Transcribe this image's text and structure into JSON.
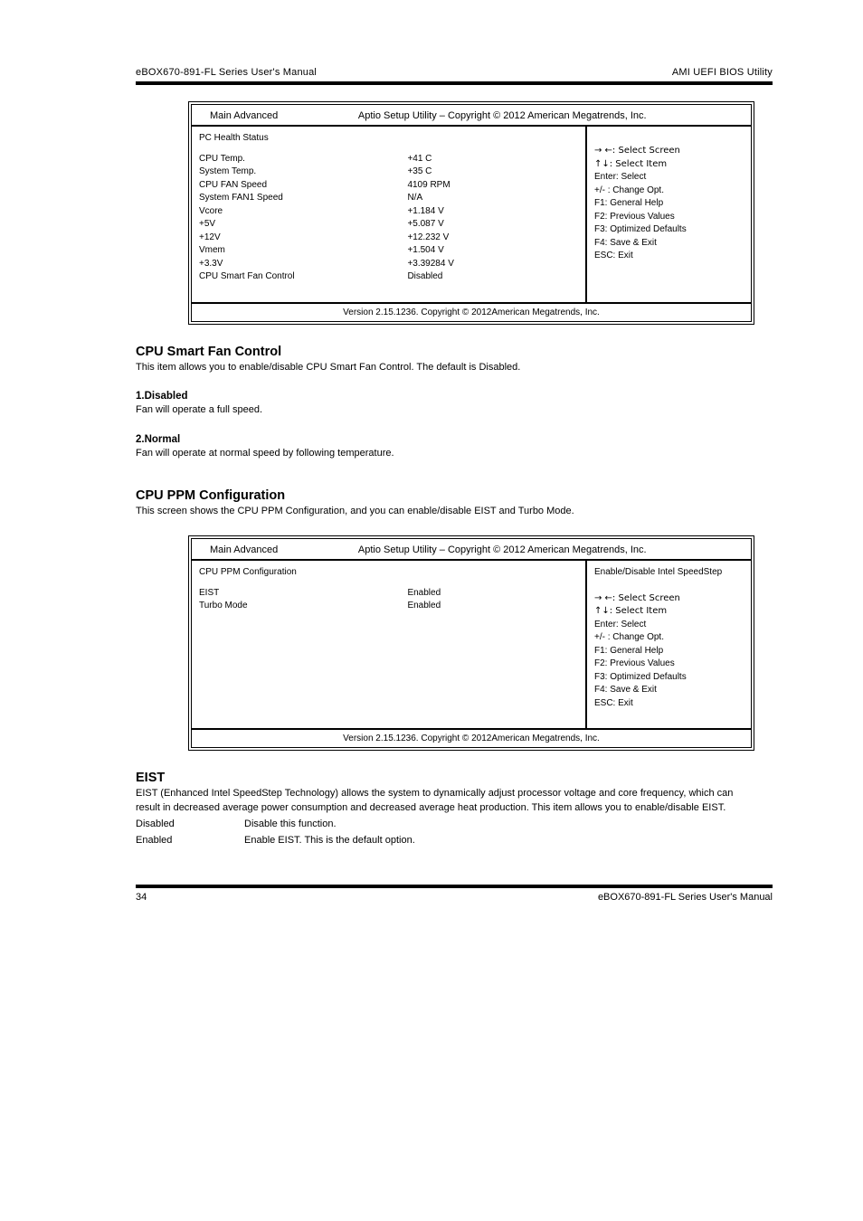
{
  "header": {
    "left": "eBOX670-891-FL Series User's Manual",
    "right": "AMI UEFI BIOS Utility"
  },
  "footer": {
    "left": "34",
    "right": "eBOX670-891-FL Series User's Manual"
  },
  "bios1": {
    "tabrange": "Main  Advanced",
    "title": "Aptio Setup Utility – Copyright © 2012 American Megatrends, Inc.",
    "heading": "PC Health Status",
    "rows": [
      {
        "label": "CPU Temp.",
        "value": "+41 C"
      },
      {
        "label": "System Temp.",
        "value": "+35 C"
      },
      {
        "label": "CPU FAN Speed",
        "value": "4109 RPM"
      },
      {
        "label": "System  FAN1 Speed",
        "value": "N/A"
      },
      {
        "label": "Vcore",
        "value": "+1.184 V"
      },
      {
        "label": "+5V",
        "value": "+5.087 V"
      },
      {
        "label": "+12V",
        "value": "+12.232 V"
      },
      {
        "label": "Vmem",
        "value": "+1.504 V"
      },
      {
        "label": "+3.3V",
        "value": "+3.39284 V"
      },
      {
        "label": "CPU Smart Fan Control",
        "value": "Disabled"
      }
    ],
    "hint": "",
    "nav": {
      "l1": "→  ←: Select Screen",
      "l2": "↑↓: Select Item",
      "l3": "Enter: Select",
      "l4": "+/- : Change Opt.",
      "l5": "F1: General Help",
      "l6": "F2: Previous Values",
      "l7": "F3: Optimized Defaults",
      "l8": "F4: Save & Exit",
      "l9": "ESC: Exit"
    },
    "copyright": "Version 2.15.1236. Copyright © 2012American Megatrends, Inc."
  },
  "sections": {
    "smartfan_title": "CPU Smart Fan Control",
    "smartfan_body": "This item allows you to enable/disable CPU Smart Fan Control. The default is Disabled.",
    "hint1_title": "1.Disabled",
    "hint1_body": "Fan will operate a full speed.",
    "hint2_title": "2.Normal",
    "hint2_body": "Fan will operate at normal speed by following temperature.",
    "cpu_ppm_heading": "CPU PPM Configuration",
    "cpu_ppm_body": "This screen shows the CPU PPM Configuration, and you can enable/disable EIST and Turbo Mode."
  },
  "bios2": {
    "tabrange": "Main  Advanced",
    "title": "Aptio Setup Utility – Copyright © 2012 American Megatrends, Inc.",
    "heading": "CPU PPM Configuration",
    "rows": [
      {
        "label": "EIST",
        "value": "Enabled"
      },
      {
        "label": "Turbo Mode",
        "value": "Enabled"
      }
    ],
    "hint": "Enable/Disable Intel SpeedStep",
    "nav": {
      "l1": "→  ←: Select Screen",
      "l2": "↑↓: Select Item",
      "l3": "Enter: Select",
      "l4": "+/- : Change Opt.",
      "l5": "F1: General Help",
      "l6": "F2: Previous Values",
      "l7": "F3: Optimized Defaults",
      "l8": "F4: Save & Exit",
      "l9": "ESC: Exit"
    },
    "copyright": "Version 2.15.1236. Copyright © 2012American Megatrends, Inc."
  },
  "eist": {
    "title": "EIST",
    "body": "EIST (Enhanced Intel SpeedStep Technology) allows the system to dynamically adjust processor voltage and core frequency, which can result in decreased average power consumption and decreased average heat production. This item allows you to enable/disable EIST.",
    "choices": [
      {
        "label": "Disabled",
        "desc": "Disable this function."
      },
      {
        "label": "Enabled",
        "desc": "Enable EIST. This is the default option."
      }
    ]
  }
}
